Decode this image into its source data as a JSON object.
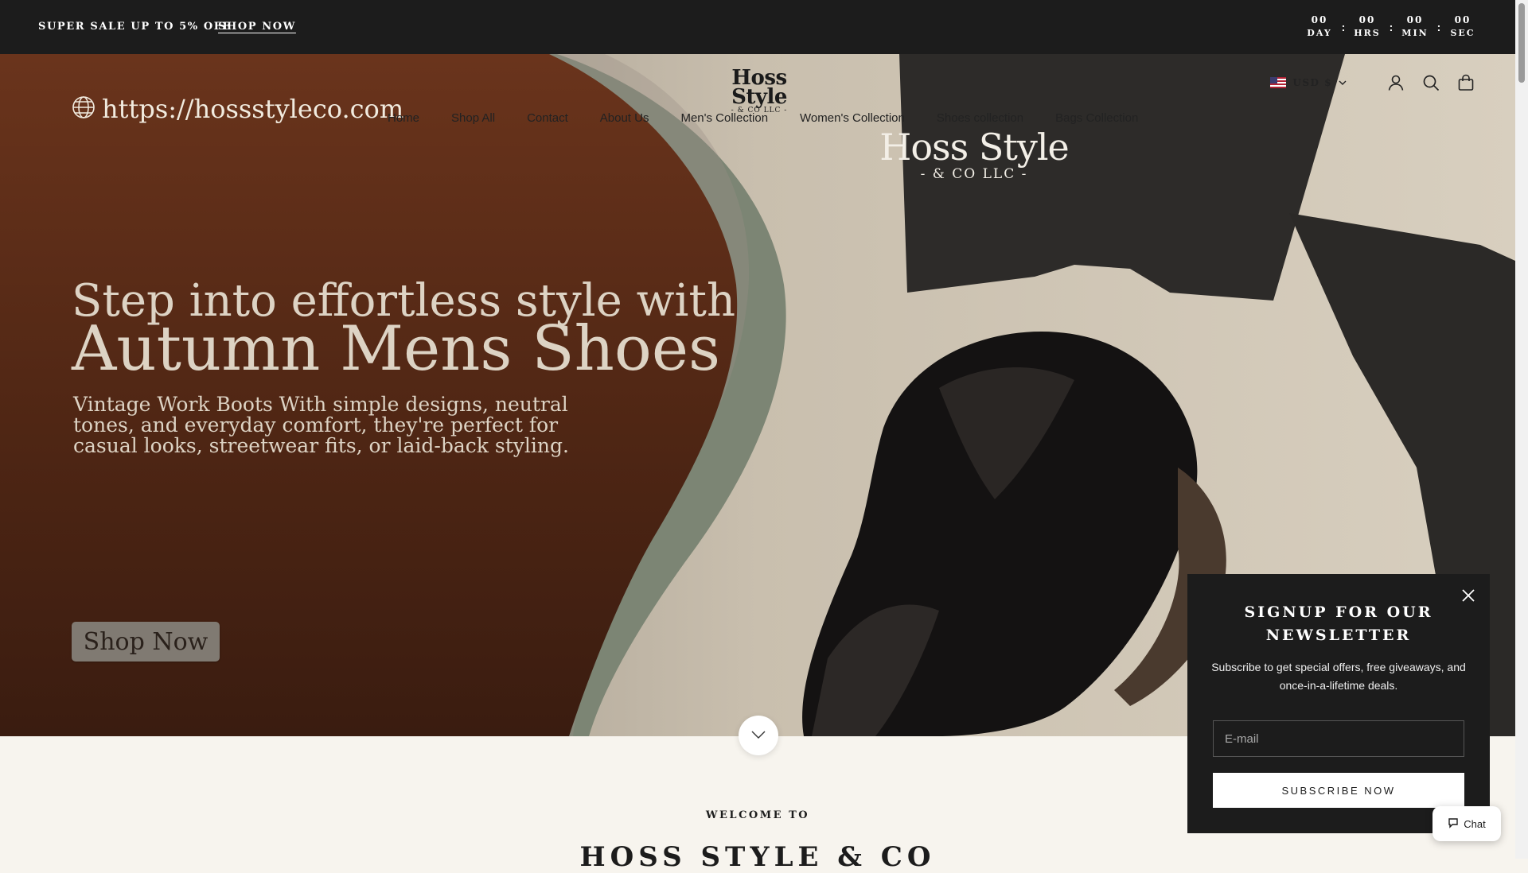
{
  "announcement": {
    "promo_text": "SUPER SALE UP TO 5% OFF",
    "promo_link": "SHOP NOW",
    "countdown": [
      {
        "value": "00",
        "label": "DAY"
      },
      {
        "value": "00",
        "label": "HRS"
      },
      {
        "value": "00",
        "label": "MIN"
      },
      {
        "value": "00",
        "label": "SEC"
      }
    ],
    "separator": ":"
  },
  "header": {
    "logo_main": "Hoss Style",
    "logo_sub": "- & CO LLC -",
    "nav": [
      "Home",
      "Shop All",
      "Contact",
      "About Us",
      "Men's Collection",
      "Women's Collection",
      "Shoes collection",
      "Bags Collection"
    ],
    "currency": "USD $",
    "icons": [
      "account-icon",
      "search-icon",
      "cart-icon"
    ]
  },
  "hero": {
    "url_text": "https://hossstyleco.com",
    "watermark_main": "Hoss Style",
    "watermark_sub": "- & CO LLC -",
    "headline_1": "Step into effortless style with",
    "headline_2": "Autumn Mens Shoes",
    "subtext": "Vintage Work Boots With simple designs, neutral tones, and everyday comfort, they're perfect for casual looks, streetwear fits, or laid-back styling.",
    "cta": "Shop Now"
  },
  "welcome": {
    "label": "WELCOME TO",
    "title": "HOSS STYLE & CO"
  },
  "newsletter": {
    "title": "SIGNUP FOR OUR NEWSLETTER",
    "text": "Subscribe to get special offers, free giveaways, and once-in-a-lifetime deals.",
    "placeholder": "E-mail",
    "button": "SUBSCRIBE NOW"
  },
  "chat": {
    "label": "Chat"
  },
  "colors": {
    "dark": "#1c1c1c",
    "hero_brown": "#5e2e18",
    "hero_sage": "#7c8574",
    "cream": "#f7f4ee"
  }
}
